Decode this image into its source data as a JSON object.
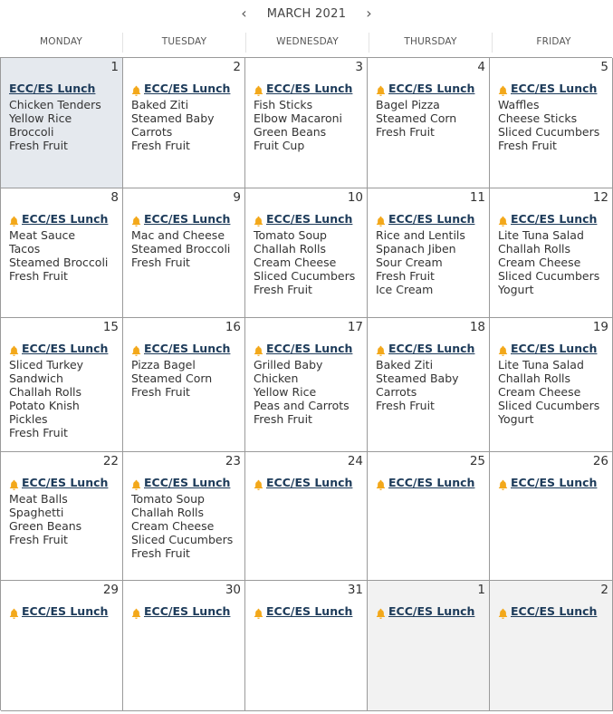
{
  "header": {
    "title": "MARCH 2021",
    "prev_symbol": "‹",
    "next_symbol": "›"
  },
  "weekdays": [
    "MONDAY",
    "TUESDAY",
    "WEDNESDAY",
    "THURSDAY",
    "FRIDAY"
  ],
  "colors": {
    "bell": "#f3a81a",
    "link": "#1d3b5a",
    "today_bg": "#e5e9ee",
    "other_month_bg": "#f2f2f2",
    "border": "#9a9a9a"
  },
  "days": [
    {
      "day": "1",
      "event": "ECC/ES Lunch",
      "bell": false,
      "state": "today",
      "menu": [
        "Chicken Tenders",
        "Yellow Rice",
        "Broccoli",
        "Fresh Fruit"
      ]
    },
    {
      "day": "2",
      "event": "ECC/ES Lunch",
      "bell": true,
      "state": "",
      "menu": [
        "Baked Ziti",
        "Steamed Baby",
        "Carrots",
        "Fresh Fruit"
      ]
    },
    {
      "day": "3",
      "event": "ECC/ES Lunch",
      "bell": true,
      "state": "",
      "menu": [
        "Fish Sticks",
        "Elbow Macaroni",
        "Green Beans",
        "Fruit Cup"
      ]
    },
    {
      "day": "4",
      "event": "ECC/ES Lunch",
      "bell": true,
      "state": "",
      "menu": [
        "Bagel Pizza",
        "Steamed Corn",
        "Fresh Fruit"
      ]
    },
    {
      "day": "5",
      "event": "ECC/ES Lunch",
      "bell": true,
      "state": "",
      "menu": [
        "Waffles",
        "Cheese Sticks",
        "Sliced Cucumbers",
        "Fresh Fruit"
      ]
    },
    {
      "day": "8",
      "event": "ECC/ES Lunch",
      "bell": true,
      "state": "",
      "menu": [
        "Meat Sauce",
        "Tacos",
        "Steamed Broccoli",
        "Fresh Fruit"
      ]
    },
    {
      "day": "9",
      "event": "ECC/ES Lunch",
      "bell": true,
      "state": "",
      "menu": [
        "Mac and Cheese",
        "Steamed Broccoli",
        "Fresh Fruit"
      ]
    },
    {
      "day": "10",
      "event": "ECC/ES Lunch",
      "bell": true,
      "state": "",
      "menu": [
        "Tomato Soup",
        "Challah Rolls",
        "Cream Cheese",
        "Sliced Cucumbers",
        "Fresh Fruit"
      ]
    },
    {
      "day": "11",
      "event": "ECC/ES Lunch",
      "bell": true,
      "state": "",
      "menu": [
        "Rice and Lentils",
        "Spanach Jiben",
        "Sour Cream",
        "Fresh Fruit",
        "Ice Cream"
      ]
    },
    {
      "day": "12",
      "event": "ECC/ES Lunch",
      "bell": true,
      "state": "",
      "menu": [
        "Lite Tuna Salad",
        "Challah Rolls",
        "Cream Cheese",
        "Sliced Cucumbers",
        "Yogurt"
      ]
    },
    {
      "day": "15",
      "event": "ECC/ES Lunch",
      "bell": true,
      "state": "",
      "menu": [
        "Sliced Turkey",
        "Sandwich",
        "Challah Rolls",
        "Potato Knish",
        "Pickles",
        "Fresh Fruit"
      ]
    },
    {
      "day": "16",
      "event": "ECC/ES Lunch",
      "bell": true,
      "state": "",
      "menu": [
        "Pizza Bagel",
        "Steamed Corn",
        "Fresh Fruit"
      ]
    },
    {
      "day": "17",
      "event": "ECC/ES Lunch",
      "bell": true,
      "state": "",
      "menu": [
        "Grilled Baby",
        "Chicken",
        "Yellow Rice",
        "Peas and Carrots",
        "Fresh Fruit"
      ]
    },
    {
      "day": "18",
      "event": "ECC/ES Lunch",
      "bell": true,
      "state": "",
      "menu": [
        "Baked Ziti",
        "Steamed Baby",
        "Carrots",
        "Fresh Fruit"
      ]
    },
    {
      "day": "19",
      "event": "ECC/ES Lunch",
      "bell": true,
      "state": "",
      "menu": [
        "Lite Tuna Salad",
        "Challah Rolls",
        "Cream Cheese",
        "Sliced Cucumbers",
        "Yogurt"
      ]
    },
    {
      "day": "22",
      "event": "ECC/ES Lunch",
      "bell": true,
      "state": "",
      "menu": [
        "Meat Balls",
        "Spaghetti",
        "Green Beans",
        "Fresh Fruit"
      ]
    },
    {
      "day": "23",
      "event": "ECC/ES Lunch",
      "bell": true,
      "state": "",
      "menu": [
        "Tomato Soup",
        "Challah Rolls",
        "Cream Cheese",
        "Sliced Cucumbers",
        "Fresh Fruit"
      ]
    },
    {
      "day": "24",
      "event": "ECC/ES Lunch",
      "bell": true,
      "state": "",
      "menu": []
    },
    {
      "day": "25",
      "event": "ECC/ES Lunch",
      "bell": true,
      "state": "",
      "menu": []
    },
    {
      "day": "26",
      "event": "ECC/ES Lunch",
      "bell": true,
      "state": "",
      "menu": []
    },
    {
      "day": "29",
      "event": "ECC/ES Lunch",
      "bell": true,
      "state": "",
      "menu": []
    },
    {
      "day": "30",
      "event": "ECC/ES Lunch",
      "bell": true,
      "state": "",
      "menu": []
    },
    {
      "day": "31",
      "event": "ECC/ES Lunch",
      "bell": true,
      "state": "",
      "menu": []
    },
    {
      "day": "1",
      "event": "ECC/ES Lunch",
      "bell": true,
      "state": "other",
      "menu": []
    },
    {
      "day": "2",
      "event": "ECC/ES Lunch",
      "bell": true,
      "state": "other",
      "menu": []
    }
  ]
}
